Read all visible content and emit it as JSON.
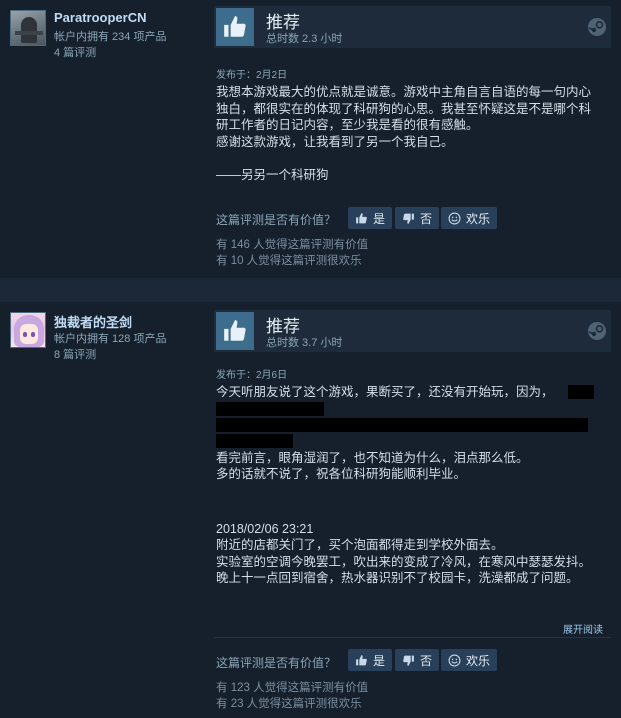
{
  "reviews": [
    {
      "author": "ParatrooperCN",
      "products_owned": "帐户内拥有 234 项产品",
      "review_count": "4 篇评测",
      "verdict": "推荐",
      "hours": "总时数 2.3 小时",
      "posted": "发布于：2月2日",
      "body": "我想本游戏最大的优点就是诚意。游戏中主角自言自语的每一句内心独白，都很实在的体现了科研狗的心思。我甚至怀疑这是不是哪个科研工作者的日记内容，至少我是看的很有感触。\n感谢这款游戏，让我看到了另一个我自己。\n\n——另另一个科研狗",
      "helpful_question": "这篇评测是否有价值？",
      "yes_label": "是",
      "no_label": "否",
      "funny_label": "欢乐",
      "helpful_count": "有 146 人觉得这篇评测有价值",
      "funny_count": "有 10 人觉得这篇评测很欢乐"
    },
    {
      "author": "独裁者的圣剑",
      "products_owned": "帐户内拥有 128 项产品",
      "review_count": "8 篇评测",
      "verdict": "推荐",
      "hours": "总时数 3.7 小时",
      "posted": "发布于：2月6日",
      "body_line1": "今天听朋友说了这个游戏，果断买了，还没有开始玩，因为，",
      "body_part2": "看完前言，眼角湿润了，也不知道为什么，泪点那么低。\n多的话就不说了，祝各位科研狗能顺利毕业。",
      "body_part3": "2018/02/06 23:21\n附近的店都关门了，买个泡面都得走到学校外面去。\n实验室的空调今晚罢工，吹出来的变成了冷风，在寒风中瑟瑟发抖。\n晚上十一点回到宿舍，热水器识别不了校园卡，洗澡都成了问题。",
      "expand_label": "展开阅读",
      "helpful_question": "这篇评测是否有价值？",
      "yes_label": "是",
      "no_label": "否",
      "funny_label": "欢乐",
      "helpful_count": "有 123 人觉得这篇评测有价值",
      "funny_count": "有 23 人觉得这篇评测很欢乐"
    }
  ],
  "colors": {
    "page_bg": "#1b2838",
    "card_bg": "#16202d",
    "thumb_bg": "#3d6c8d",
    "button_bg": "#28405a",
    "author_name": "#c1dbf4"
  },
  "icons": [
    "thumbs-up-icon",
    "thumbs-down-icon",
    "smiley-icon",
    "steam-logo-icon"
  ]
}
